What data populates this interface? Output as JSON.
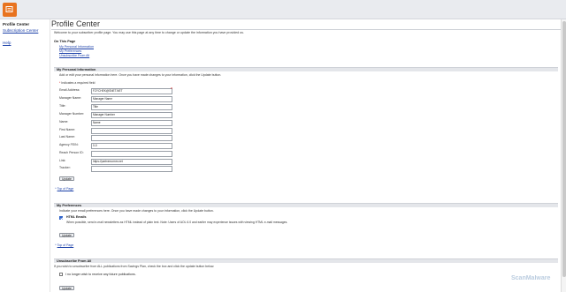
{
  "colors": {
    "brand": "#e8731f",
    "link": "#1a3fa8",
    "required": "#d81b1b",
    "header_bg": "#e9ebef",
    "section_bg": "#e4e6ea"
  },
  "icons": {
    "logo": "logo-icon"
  },
  "sidebar": {
    "title": "Profile Center",
    "items": [
      {
        "label": "Subscription Center"
      },
      {
        "label": "Help"
      }
    ]
  },
  "header": {
    "title": "Profile Center",
    "intro": "Welcome to your subscriber profile page. You may use this page at any time to change or update the information you have provided us."
  },
  "on_this_page": {
    "title": "On This Page",
    "links": [
      "My Personal Information",
      "My Preferences",
      "Unsubscribe From All"
    ]
  },
  "personal": {
    "header": "My Personal Information",
    "description": "Add or edit your personal information here. Once you have made changes to your information, click the Update button.",
    "required_note": "Indicates a required field",
    "fields": [
      {
        "label": "Email Address:",
        "value": "FZYCHEK@SNET.NET"
      },
      {
        "label": "Manager Name:",
        "value": "Manager Name"
      },
      {
        "label": "Title:",
        "value": "Title"
      },
      {
        "label": "Manager Number:",
        "value": "Manager Number"
      },
      {
        "label": "Name:",
        "value": "Name"
      },
      {
        "label": "First Name:",
        "value": ""
      },
      {
        "label": "Last Name:",
        "value": ""
      },
      {
        "label": "Agency FEIN:",
        "value": "0-0"
      },
      {
        "label": "Reach Person ID:",
        "value": ""
      },
      {
        "label": "Link:",
        "value": "https://partnercomm.net"
      },
      {
        "label": "Tracker:",
        "value": ""
      }
    ],
    "update_label": "Update",
    "top_label": "Top of Page"
  },
  "preferences": {
    "header": "My Preferences",
    "description": "Indicate your email preferences here. Once you have made changes to your information, click the Update button.",
    "html_label": "HTML Emails",
    "html_checked": true,
    "html_help": "When possible, send e-mail newsletters as HTML instead of plain text. Note: Users of AOL 6.0 and earlier may experience issues with viewing HTML e-mail messages.",
    "update_label": "Update",
    "top_label": "Top of Page"
  },
  "unsubscribe": {
    "header": "Unsubscribe From All",
    "description": "If you wish to unsubscribe from ALL publications from Savings Plan, check the box and click the update button below.",
    "checkbox_label": "I no longer wish to receive any future publications.",
    "checked": false,
    "update_label": "Update"
  },
  "watermark": "ScanMalware"
}
